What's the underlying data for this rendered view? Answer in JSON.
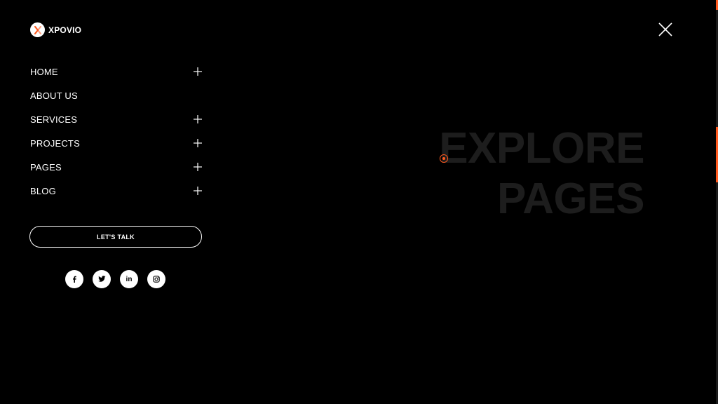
{
  "brand": {
    "name": "XPOVIO",
    "accent_color": "#ff5a1f"
  },
  "menu": {
    "items": [
      {
        "label": "HOME",
        "has_submenu": true
      },
      {
        "label": "ABOUT US",
        "has_submenu": false
      },
      {
        "label": "SERVICES",
        "has_submenu": true
      },
      {
        "label": "PROJECTS",
        "has_submenu": true
      },
      {
        "label": "PAGES",
        "has_submenu": true
      },
      {
        "label": "BLOG",
        "has_submenu": true
      }
    ]
  },
  "cta": {
    "label": "LET'S TALK"
  },
  "socials": [
    {
      "icon": "facebook-icon"
    },
    {
      "icon": "twitter-icon"
    },
    {
      "icon": "linkedin-icon",
      "text": "in"
    },
    {
      "icon": "instagram-icon"
    }
  ],
  "headline": {
    "line1": "EXPLORE",
    "line2": "PAGES"
  },
  "close": {
    "icon": "close-icon"
  }
}
